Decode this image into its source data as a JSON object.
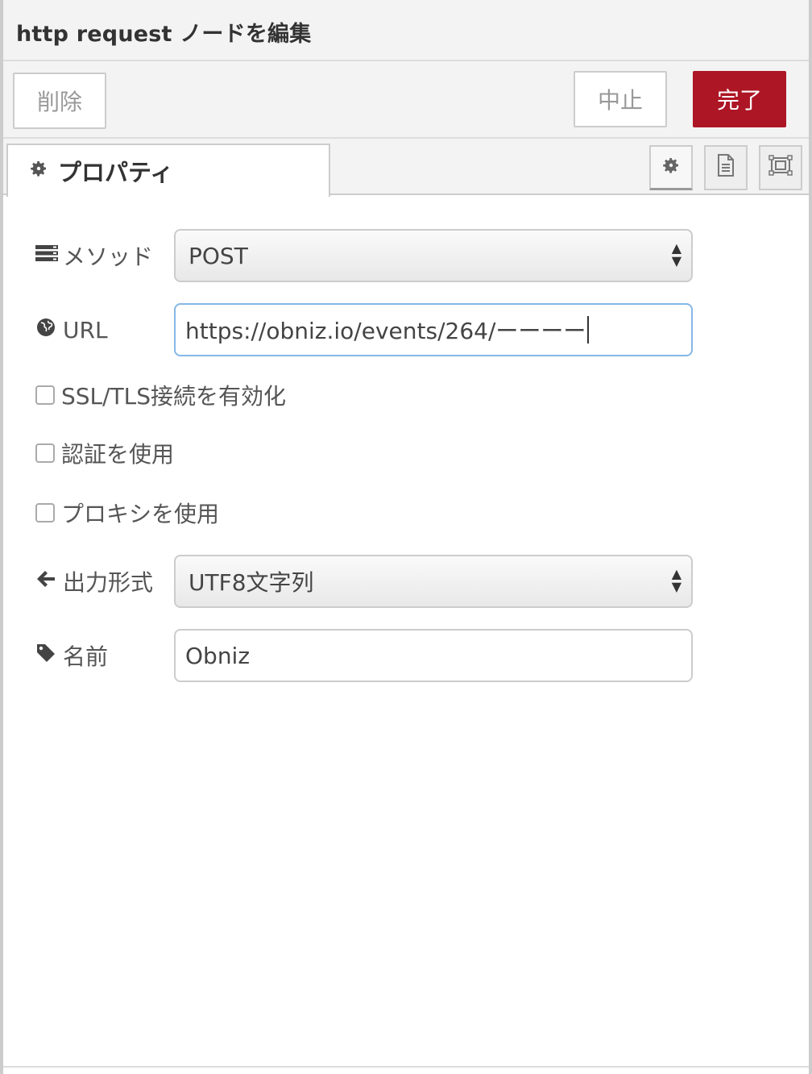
{
  "dialog": {
    "title": "http request ノードを編集"
  },
  "toolbar": {
    "delete_label": "削除",
    "cancel_label": "中止",
    "done_label": "完了",
    "done_color": "#ad1625"
  },
  "tabs": {
    "properties_label": "プロパティ",
    "properties_icon": "gear-icon",
    "buttons": [
      {
        "icon": "gear-icon"
      },
      {
        "icon": "document-icon"
      },
      {
        "icon": "frame-icon"
      }
    ]
  },
  "form": {
    "method": {
      "label": "メソッド",
      "icon": "list-icon",
      "value": "POST"
    },
    "url": {
      "label": "URL",
      "icon": "globe-icon",
      "value": "https://obniz.io/events/264/ーーーー"
    },
    "ssl": {
      "label": "SSL/TLS接続を有効化",
      "checked": false
    },
    "auth": {
      "label": "認証を使用",
      "checked": false
    },
    "proxy": {
      "label": "プロキシを使用",
      "checked": false
    },
    "output": {
      "label": "出力形式",
      "icon": "arrow-left-icon",
      "value": "UTF8文字列"
    },
    "name": {
      "label": "名前",
      "icon": "tag-icon",
      "value": "Obniz"
    }
  }
}
